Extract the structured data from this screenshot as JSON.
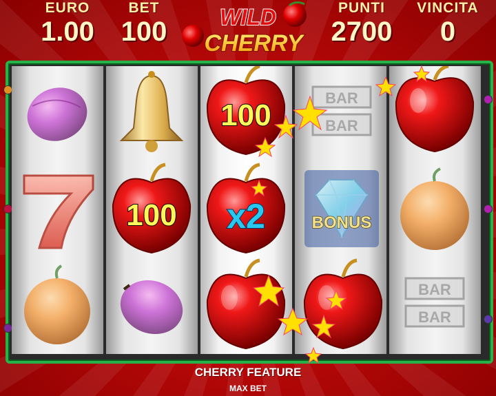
{
  "header": {
    "euro_label": "EURO",
    "euro_value": "1.00",
    "bet_label": "BET",
    "bet_value": "100",
    "punti_label": "PUNTI",
    "punti_value": "2700",
    "vincita_label": "VINCITA",
    "vincita_value": "0"
  },
  "logo": {
    "line1": "WILD",
    "line2": "CHERRY"
  },
  "reels": [
    {
      "symbols": [
        "plum-icon",
        "seven-icon",
        "orange-icon"
      ]
    },
    {
      "symbols": [
        "bell-icon",
        "cherry-100",
        "plum-icon"
      ]
    },
    {
      "symbols": [
        "cherry-100",
        "cherry-x2",
        "cherry-icon"
      ]
    },
    {
      "symbols": [
        "bar-bar-icon",
        "diamond-bonus-icon",
        "cherry-icon"
      ]
    },
    {
      "symbols": [
        "cherry-icon",
        "orange-icon",
        "bar-bar-icon"
      ]
    }
  ],
  "symbol_text": {
    "cherry_100": "100",
    "cherry_100_b": "100",
    "cherry_x2": "x2",
    "bar_1": "BAR",
    "bar_2": "BAR",
    "bar_3": "BAR",
    "bar_4": "BAR",
    "bonus": "BONUS"
  },
  "footer": {
    "feature": "CHERRY FEATURE",
    "max_bet": "MAX BET"
  },
  "colors": {
    "frame": "#27b34a",
    "background": "#c00000",
    "header_text": "#fff6c8",
    "cherry": "#e00000"
  }
}
